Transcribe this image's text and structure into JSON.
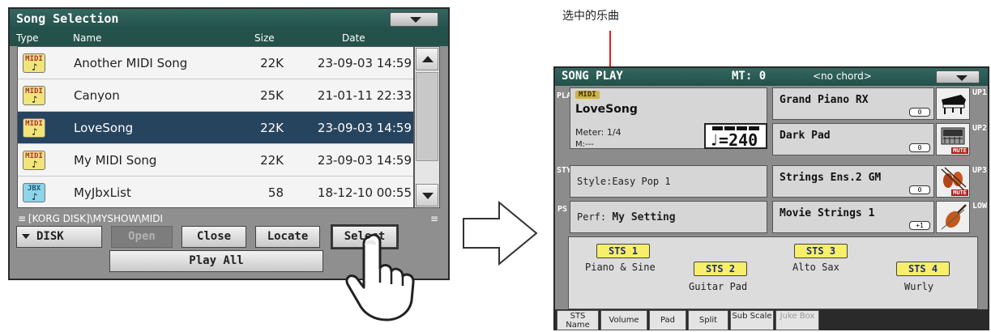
{
  "song_selection": {
    "title": "Song Selection",
    "columns": {
      "type": "Type",
      "name": "Name",
      "size": "Size",
      "date": "Date"
    },
    "rows": [
      {
        "type": "MIDI",
        "name": "Another MIDI Song",
        "size": "22K",
        "date": "23-09-03 14:59",
        "selected": false
      },
      {
        "type": "MIDI",
        "name": "Canyon",
        "size": "25K",
        "date": "21-01-11 22:33",
        "selected": false
      },
      {
        "type": "MIDI",
        "name": "LoveSong",
        "size": "22K",
        "date": "23-09-03 14:59",
        "selected": true
      },
      {
        "type": "MIDI",
        "name": "My MIDI Song",
        "size": "22K",
        "date": "23-09-03 14:59",
        "selected": false
      },
      {
        "type": "JBX",
        "name": "MyJbxList",
        "size": "58",
        "date": "18-12-10 00:55",
        "selected": false
      }
    ],
    "path": "[KORG DISK]\\MYSHOW\\MIDI",
    "path_grip": "≡",
    "buttons": {
      "disk": "DISK",
      "open": "Open",
      "close": "Close",
      "locate": "Locate",
      "select": "Select",
      "play_all": "Play All"
    },
    "selected_color": "#27445e"
  },
  "annotation": {
    "callout": "选中的乐曲",
    "color": "#e21c24"
  },
  "song_play": {
    "title": "SONG PLAY",
    "mt": "MT: 0",
    "chord": "<no chord>",
    "player": {
      "side_label": "PLAYER",
      "file_type": "MIDI",
      "song_name": "LoveSong",
      "meter": "Meter: 1/4",
      "measure": "M:---",
      "tempo": "♩=240"
    },
    "style": {
      "side_label": "STY",
      "text": "Style:Easy Pop 1"
    },
    "perf": {
      "side_label": "PS",
      "label": "Perf:",
      "value": "My Setting"
    },
    "sounds": [
      {
        "name": "Grand Piano RX",
        "octave": "0",
        "icon": "grand-piano-icon",
        "mute": "",
        "tag": "UP1"
      },
      {
        "name": "Dark Pad",
        "octave": "0",
        "icon": "synth-pad-icon",
        "mute": "MUTE",
        "tag": "UP2"
      },
      {
        "name": "Strings Ens.2 GM",
        "octave": "0",
        "icon": "strings-ensemble-icon",
        "mute": "MUTE",
        "tag": "UP3"
      },
      {
        "name": "Movie Strings 1",
        "octave": "+1",
        "icon": "violin-icon",
        "mute": "",
        "tag": "LOW"
      }
    ],
    "sts": [
      {
        "button": "STS 1",
        "label": "Piano & Sine"
      },
      {
        "button": "STS 2",
        "label": "Guitar Pad"
      },
      {
        "button": "STS 3",
        "label": "Alto Sax"
      },
      {
        "button": "STS 4",
        "label": "Wurly"
      }
    ],
    "tabs": [
      {
        "label": "STS Name",
        "active": true
      },
      {
        "label": "Volume",
        "active": false
      },
      {
        "label": "Pad",
        "active": false
      },
      {
        "label": "Split",
        "active": false
      },
      {
        "label": "Sub Scale",
        "active": false
      },
      {
        "label": "Juke Box",
        "active": false,
        "disabled": true
      }
    ],
    "colors": {
      "header": "#2d5f58",
      "sts_button": "#f7ef6a",
      "mute": "#b41c1c"
    }
  }
}
